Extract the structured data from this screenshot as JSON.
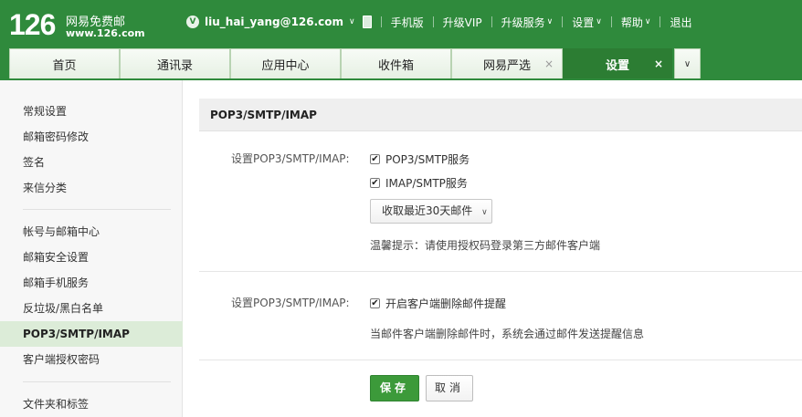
{
  "header": {
    "logo_number": "126",
    "logo_text": "网易免费邮",
    "logo_url": "www.126.com",
    "vip_badge": "V",
    "username": "liu_hai_yang@126.com",
    "links": [
      "手机版",
      "升级VIP",
      "升级服务",
      "设置",
      "帮助",
      "退出"
    ]
  },
  "tabs": [
    {
      "label": "首页"
    },
    {
      "label": "通讯录"
    },
    {
      "label": "应用中心"
    },
    {
      "label": "收件箱"
    },
    {
      "label": "网易严选",
      "close": "×"
    },
    {
      "label": "设置",
      "close": "×"
    }
  ],
  "sidebar": {
    "items": [
      "常规设置",
      "邮箱密码修改",
      "签名",
      "来信分类",
      "帐号与邮箱中心",
      "邮箱安全设置",
      "邮箱手机服务",
      "反垃圾/黑白名单",
      "POP3/SMTP/IMAP",
      "客户端授权密码",
      "文件夹和标签"
    ],
    "active": "POP3/SMTP/IMAP"
  },
  "main": {
    "section_title": "POP3/SMTP/IMAP",
    "group1": {
      "label": "设置POP3/SMTP/IMAP:",
      "option1": "POP3/SMTP服务",
      "option2": "IMAP/SMTP服务",
      "select_value": "收取最近30天邮件",
      "hint": "温馨提示：请使用授权码登录第三方邮件客户端"
    },
    "group2": {
      "label": "设置POP3/SMTP/IMAP:",
      "option": "开启客户端删除邮件提醒",
      "hint": "当邮件客户端删除邮件时，系统会通过邮件发送提醒信息"
    },
    "save_label": "保存",
    "cancel_label": "取消"
  },
  "colors": {
    "header_green": "#2f8a3c",
    "active_tab": "#2c7d33",
    "save_button": "#3c9a3a",
    "active_sidebar": "#dcecd8"
  }
}
